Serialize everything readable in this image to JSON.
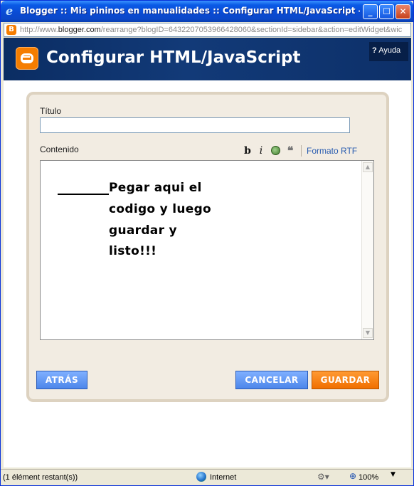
{
  "window": {
    "title": "Blogger :: Mis pininos en manualidades :: Configurar HTML/JavaScript - Wi...",
    "min_glyph": "_",
    "max_glyph": "☐",
    "close_glyph": "✕"
  },
  "address": {
    "url_prefix": "http://www.",
    "url_domain": "blogger.com",
    "url_rest": "/rearrange?blogID=6432207053966428060&sectionId=sidebar&action=editWidget&wic"
  },
  "header": {
    "title": "Configurar HTML/JavaScript",
    "help_mark": "?",
    "help_label": "Ayuda"
  },
  "form": {
    "title_label": "Título",
    "title_value": "",
    "content_label": "Contenido",
    "toolbar": {
      "bold": "b",
      "italic": "i",
      "quote": "❝",
      "rtf_link": "Formato RTF"
    },
    "editor_lines": [
      "Pegar aqui el",
      "codigo y luego",
      "guardar y",
      "listo!!!"
    ]
  },
  "buttons": {
    "back": "ATRÁS",
    "cancel": "CANCELAR",
    "save": "GUARDAR"
  },
  "statusbar": {
    "status": "(1 élément restant(s))",
    "zone": "Internet",
    "zoom": "100%"
  },
  "colors": {
    "accent_orange": "#f57d00",
    "header_navy": "#0b2d63",
    "button_blue": "#4d86ea",
    "link_blue": "#2a5db0"
  }
}
